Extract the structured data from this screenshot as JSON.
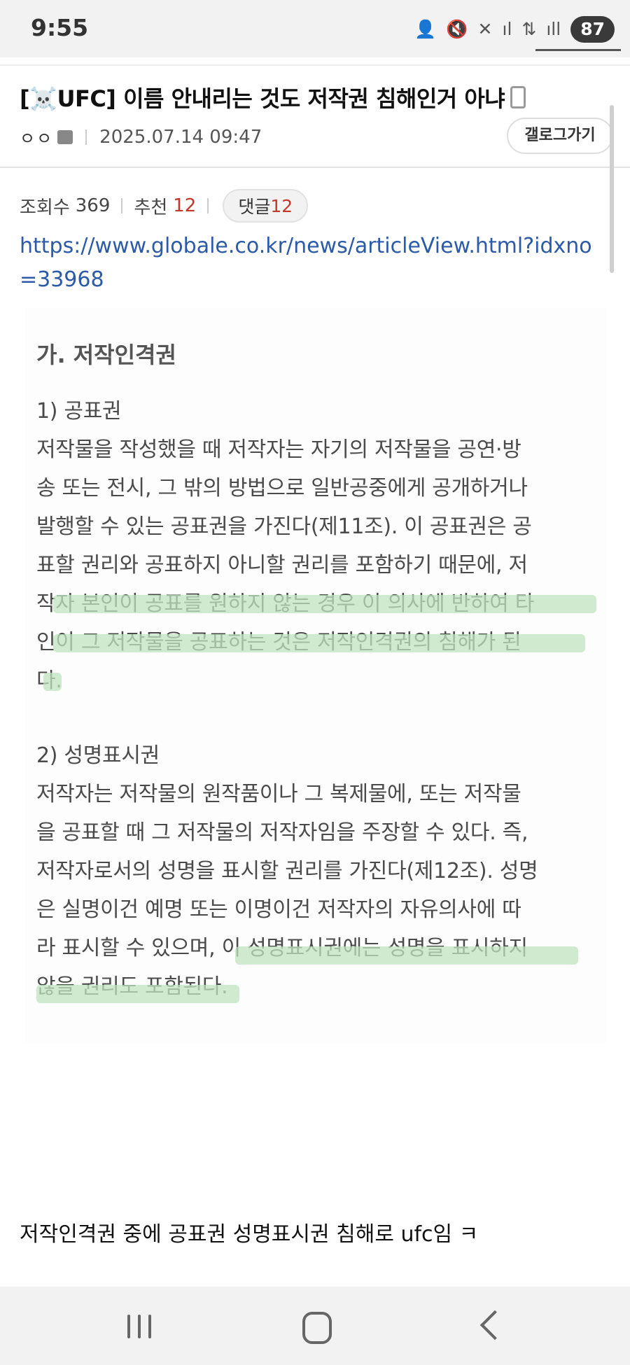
{
  "status_bar": {
    "time": "9:55",
    "battery": "87",
    "icons": [
      "profile-sync-icon",
      "mute-icon",
      "no-alarm-icon",
      "signal-r-icon",
      "lte-4g-icon",
      "signal-icon"
    ]
  },
  "post": {
    "title": "[☠️UFC] 이름 안내리는 것도 저작권 침해인거 아냐",
    "author": "ㅇㅇ",
    "datetime": "2025.07.14 09:47",
    "gallery_button": "갤로그가기",
    "views_label": "조회수",
    "views": "369",
    "likes_label": "추천",
    "likes": "12",
    "comments_label": "댓글",
    "comments": "12",
    "link": "https://www.globale.co.kr/news/articleView.html?idxno=33968"
  },
  "article_image": {
    "section_title": "가. 저작인격권",
    "block1": [
      "1) 공표권",
      "저작물을 작성했을 때 저작자는 자기의 저작물을 공연·방",
      "송 또는 전시, 그 밖의 방법으로 일반공중에게 공개하거나",
      "발행할 수 있는 공표권을 가진다(제11조). 이 공표권은 공",
      "표할 권리와 공표하지 아니할 권리를 포함하기 때문에, 저",
      "작자 본인이 공표를 원하지 않는 경우 이 의사에 반하여 타",
      "인이 그 저작물을 공표하는 것은 저작인격권의 침해가 된",
      "다."
    ],
    "block2": [
      "2) 성명표시권",
      "저작자는 저작물의 원작품이나 그 복제물에, 또는 저작물",
      "을 공표할 때 그 저작물의 저작자임을 주장할 수 있다. 즉,",
      "저작자로서의 성명을 표시할 권리를 가진다(제12조). 성명",
      "은 실명이건 예명 또는 이명이건 저작자의 자유의사에 따",
      "라 표시할 수 있으며, 이 성명표시권에는 성명을 표시하지",
      "않을 권리도 포함된다."
    ]
  },
  "body_text": "저작인격권 중에 공표권 성명표시권 침해로 ufc임 ㅋ",
  "colors": {
    "link": "#2a5aa8",
    "count_red": "#c0392b",
    "highlight": "#bfe3bf"
  }
}
